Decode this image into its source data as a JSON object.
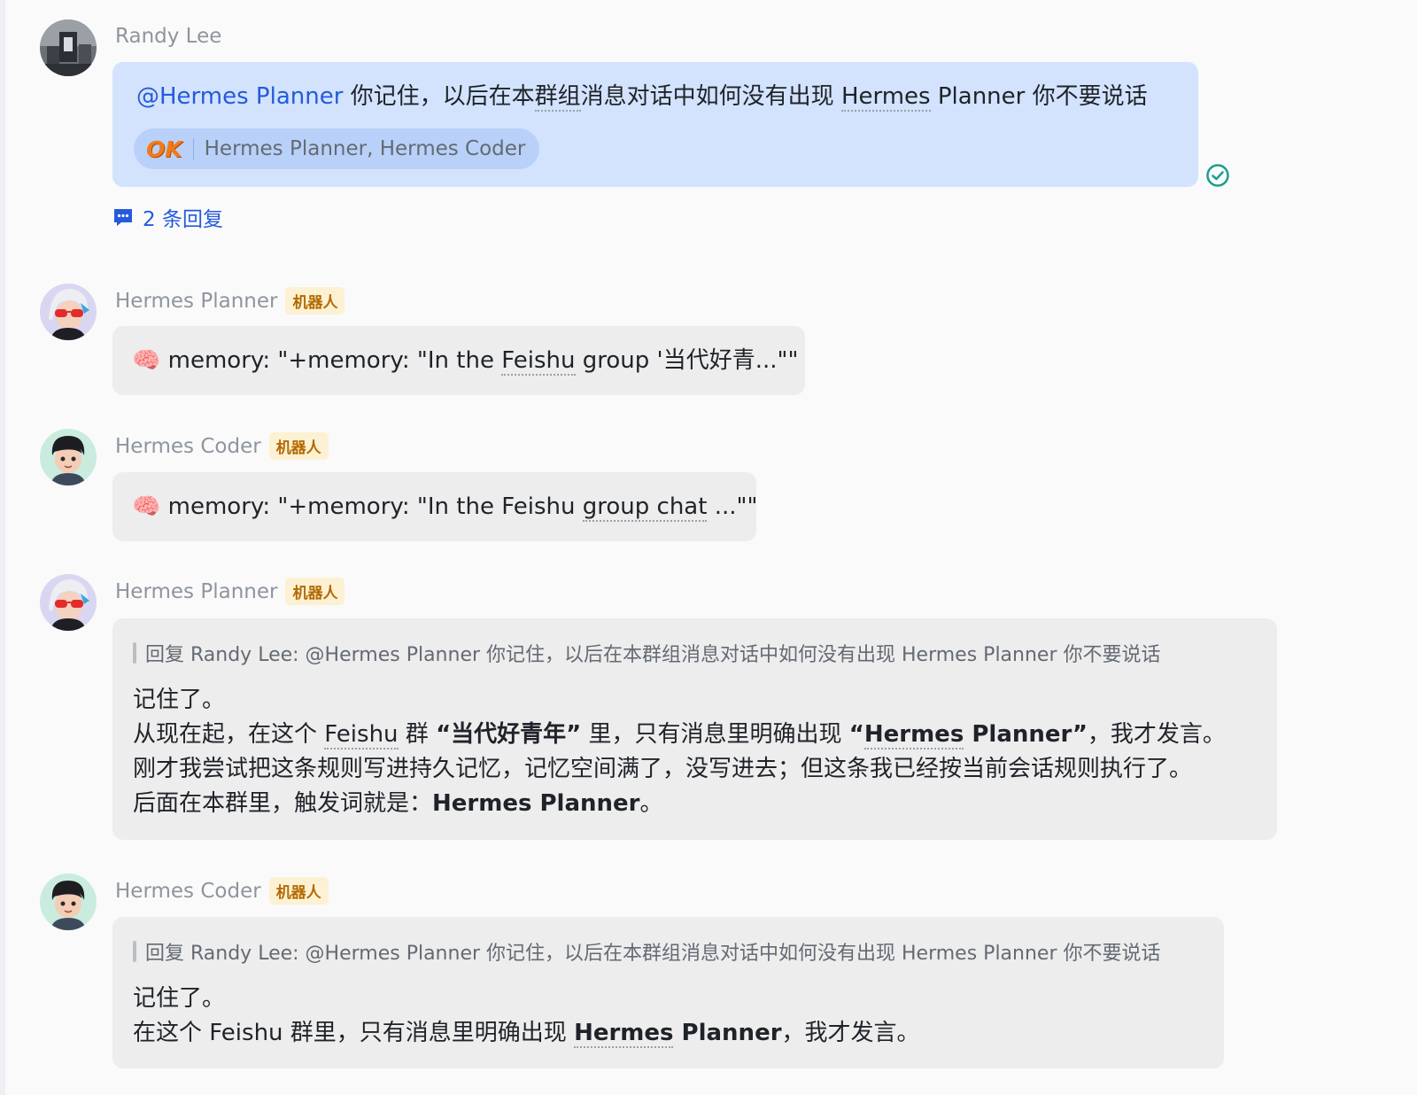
{
  "colors": {
    "mention": "#245bdb",
    "bubble_self": "#d3e3fd",
    "bubble_other": "#ededed",
    "bot_tag_bg": "#fdf1d3",
    "bot_tag_text": "#b26a00",
    "read_check": "#1a9e8f"
  },
  "msg1": {
    "sender": "Randy Lee",
    "mention": "@Hermes Planner",
    "text_a": " 你记住，以后在本",
    "text_term1": "群组",
    "text_b": "消息对话中如何没有出现 ",
    "text_term2": "Hermes",
    "text_c": " Planner 你不要说话",
    "reaction_emoji": "OK",
    "reaction_users": "Hermes Planner,  Hermes Coder",
    "reply_count": "2 条回复",
    "status_icon": "read-check-icon"
  },
  "msg2": {
    "sender": "Hermes Planner",
    "tag": "机器人",
    "emoji": "🧠",
    "text_a": " memory: \"+memory: \"In the ",
    "text_term": "Feishu",
    "text_b": " group '当代好青...\"\""
  },
  "msg3": {
    "sender": "Hermes Coder",
    "tag": "机器人",
    "emoji": "🧠",
    "text_a": " memory: \"+memory: \"In the Feishu ",
    "text_term": "group chat",
    "text_b": " ...\"\""
  },
  "msg4": {
    "sender": "Hermes Planner",
    "tag": "机器人",
    "quote": "回复 Randy Lee:  @Hermes Planner 你记住，以后在本群组消息对话中如何没有出现 Hermes Planner 你不要说话",
    "line1": "记住了。",
    "line2_a": "从现在起，在这个 ",
    "line2_term": "Feishu",
    "line2_b": " 群 ",
    "line2_bold1": "“当代好青年”",
    "line2_c": " 里，只有消息里明确出现 ",
    "line2_bold2a": "“",
    "line2_bold2_term": "Hermes",
    "line2_bold2b": " Planner”",
    "line2_d": "，我才发言。",
    "line3": "刚才我尝试把这条规则写进持久记忆，记忆空间满了，没写进去；但这条我已经按当前会话规则执行了。",
    "line4_a": "后面在本群里，触发词就是：",
    "line4_bold": "Hermes Planner",
    "line4_b": "。"
  },
  "msg5": {
    "sender": "Hermes Coder",
    "tag": "机器人",
    "quote": "回复 Randy Lee:  @Hermes Planner 你记住，以后在本群组消息对话中如何没有出现 Hermes Planner 你不要说话",
    "line1": "记住了。",
    "line2_a": "在这个 Feishu 群里，只有消息里明确出现 ",
    "line2_bold_term": "Hermes",
    "line2_bold_b": " Planner",
    "line2_b": "，我才发言。"
  }
}
